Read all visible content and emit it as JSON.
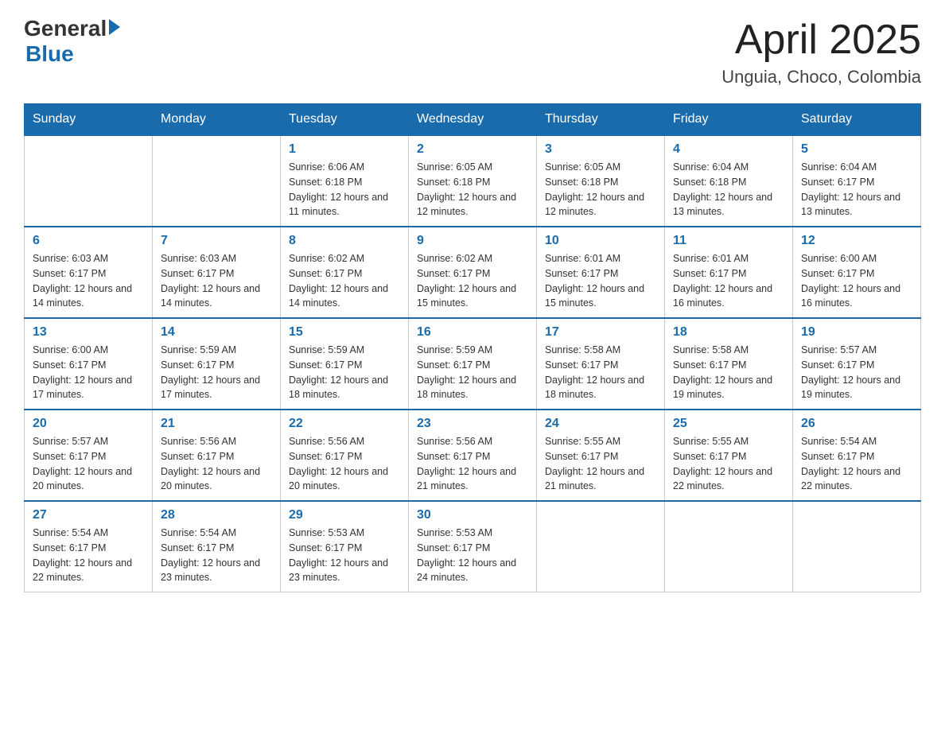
{
  "header": {
    "logo_general": "General",
    "logo_blue": "Blue",
    "month_title": "April 2025",
    "location": "Unguia, Choco, Colombia"
  },
  "days_of_week": [
    "Sunday",
    "Monday",
    "Tuesday",
    "Wednesday",
    "Thursday",
    "Friday",
    "Saturday"
  ],
  "weeks": [
    [
      {
        "day": "",
        "sunrise": "",
        "sunset": "",
        "daylight": ""
      },
      {
        "day": "",
        "sunrise": "",
        "sunset": "",
        "daylight": ""
      },
      {
        "day": "1",
        "sunrise": "Sunrise: 6:06 AM",
        "sunset": "Sunset: 6:18 PM",
        "daylight": "Daylight: 12 hours and 11 minutes."
      },
      {
        "day": "2",
        "sunrise": "Sunrise: 6:05 AM",
        "sunset": "Sunset: 6:18 PM",
        "daylight": "Daylight: 12 hours and 12 minutes."
      },
      {
        "day": "3",
        "sunrise": "Sunrise: 6:05 AM",
        "sunset": "Sunset: 6:18 PM",
        "daylight": "Daylight: 12 hours and 12 minutes."
      },
      {
        "day": "4",
        "sunrise": "Sunrise: 6:04 AM",
        "sunset": "Sunset: 6:18 PM",
        "daylight": "Daylight: 12 hours and 13 minutes."
      },
      {
        "day": "5",
        "sunrise": "Sunrise: 6:04 AM",
        "sunset": "Sunset: 6:17 PM",
        "daylight": "Daylight: 12 hours and 13 minutes."
      }
    ],
    [
      {
        "day": "6",
        "sunrise": "Sunrise: 6:03 AM",
        "sunset": "Sunset: 6:17 PM",
        "daylight": "Daylight: 12 hours and 14 minutes."
      },
      {
        "day": "7",
        "sunrise": "Sunrise: 6:03 AM",
        "sunset": "Sunset: 6:17 PM",
        "daylight": "Daylight: 12 hours and 14 minutes."
      },
      {
        "day": "8",
        "sunrise": "Sunrise: 6:02 AM",
        "sunset": "Sunset: 6:17 PM",
        "daylight": "Daylight: 12 hours and 14 minutes."
      },
      {
        "day": "9",
        "sunrise": "Sunrise: 6:02 AM",
        "sunset": "Sunset: 6:17 PM",
        "daylight": "Daylight: 12 hours and 15 minutes."
      },
      {
        "day": "10",
        "sunrise": "Sunrise: 6:01 AM",
        "sunset": "Sunset: 6:17 PM",
        "daylight": "Daylight: 12 hours and 15 minutes."
      },
      {
        "day": "11",
        "sunrise": "Sunrise: 6:01 AM",
        "sunset": "Sunset: 6:17 PM",
        "daylight": "Daylight: 12 hours and 16 minutes."
      },
      {
        "day": "12",
        "sunrise": "Sunrise: 6:00 AM",
        "sunset": "Sunset: 6:17 PM",
        "daylight": "Daylight: 12 hours and 16 minutes."
      }
    ],
    [
      {
        "day": "13",
        "sunrise": "Sunrise: 6:00 AM",
        "sunset": "Sunset: 6:17 PM",
        "daylight": "Daylight: 12 hours and 17 minutes."
      },
      {
        "day": "14",
        "sunrise": "Sunrise: 5:59 AM",
        "sunset": "Sunset: 6:17 PM",
        "daylight": "Daylight: 12 hours and 17 minutes."
      },
      {
        "day": "15",
        "sunrise": "Sunrise: 5:59 AM",
        "sunset": "Sunset: 6:17 PM",
        "daylight": "Daylight: 12 hours and 18 minutes."
      },
      {
        "day": "16",
        "sunrise": "Sunrise: 5:59 AM",
        "sunset": "Sunset: 6:17 PM",
        "daylight": "Daylight: 12 hours and 18 minutes."
      },
      {
        "day": "17",
        "sunrise": "Sunrise: 5:58 AM",
        "sunset": "Sunset: 6:17 PM",
        "daylight": "Daylight: 12 hours and 18 minutes."
      },
      {
        "day": "18",
        "sunrise": "Sunrise: 5:58 AM",
        "sunset": "Sunset: 6:17 PM",
        "daylight": "Daylight: 12 hours and 19 minutes."
      },
      {
        "day": "19",
        "sunrise": "Sunrise: 5:57 AM",
        "sunset": "Sunset: 6:17 PM",
        "daylight": "Daylight: 12 hours and 19 minutes."
      }
    ],
    [
      {
        "day": "20",
        "sunrise": "Sunrise: 5:57 AM",
        "sunset": "Sunset: 6:17 PM",
        "daylight": "Daylight: 12 hours and 20 minutes."
      },
      {
        "day": "21",
        "sunrise": "Sunrise: 5:56 AM",
        "sunset": "Sunset: 6:17 PM",
        "daylight": "Daylight: 12 hours and 20 minutes."
      },
      {
        "day": "22",
        "sunrise": "Sunrise: 5:56 AM",
        "sunset": "Sunset: 6:17 PM",
        "daylight": "Daylight: 12 hours and 20 minutes."
      },
      {
        "day": "23",
        "sunrise": "Sunrise: 5:56 AM",
        "sunset": "Sunset: 6:17 PM",
        "daylight": "Daylight: 12 hours and 21 minutes."
      },
      {
        "day": "24",
        "sunrise": "Sunrise: 5:55 AM",
        "sunset": "Sunset: 6:17 PM",
        "daylight": "Daylight: 12 hours and 21 minutes."
      },
      {
        "day": "25",
        "sunrise": "Sunrise: 5:55 AM",
        "sunset": "Sunset: 6:17 PM",
        "daylight": "Daylight: 12 hours and 22 minutes."
      },
      {
        "day": "26",
        "sunrise": "Sunrise: 5:54 AM",
        "sunset": "Sunset: 6:17 PM",
        "daylight": "Daylight: 12 hours and 22 minutes."
      }
    ],
    [
      {
        "day": "27",
        "sunrise": "Sunrise: 5:54 AM",
        "sunset": "Sunset: 6:17 PM",
        "daylight": "Daylight: 12 hours and 22 minutes."
      },
      {
        "day": "28",
        "sunrise": "Sunrise: 5:54 AM",
        "sunset": "Sunset: 6:17 PM",
        "daylight": "Daylight: 12 hours and 23 minutes."
      },
      {
        "day": "29",
        "sunrise": "Sunrise: 5:53 AM",
        "sunset": "Sunset: 6:17 PM",
        "daylight": "Daylight: 12 hours and 23 minutes."
      },
      {
        "day": "30",
        "sunrise": "Sunrise: 5:53 AM",
        "sunset": "Sunset: 6:17 PM",
        "daylight": "Daylight: 12 hours and 24 minutes."
      },
      {
        "day": "",
        "sunrise": "",
        "sunset": "",
        "daylight": ""
      },
      {
        "day": "",
        "sunrise": "",
        "sunset": "",
        "daylight": ""
      },
      {
        "day": "",
        "sunrise": "",
        "sunset": "",
        "daylight": ""
      }
    ]
  ]
}
